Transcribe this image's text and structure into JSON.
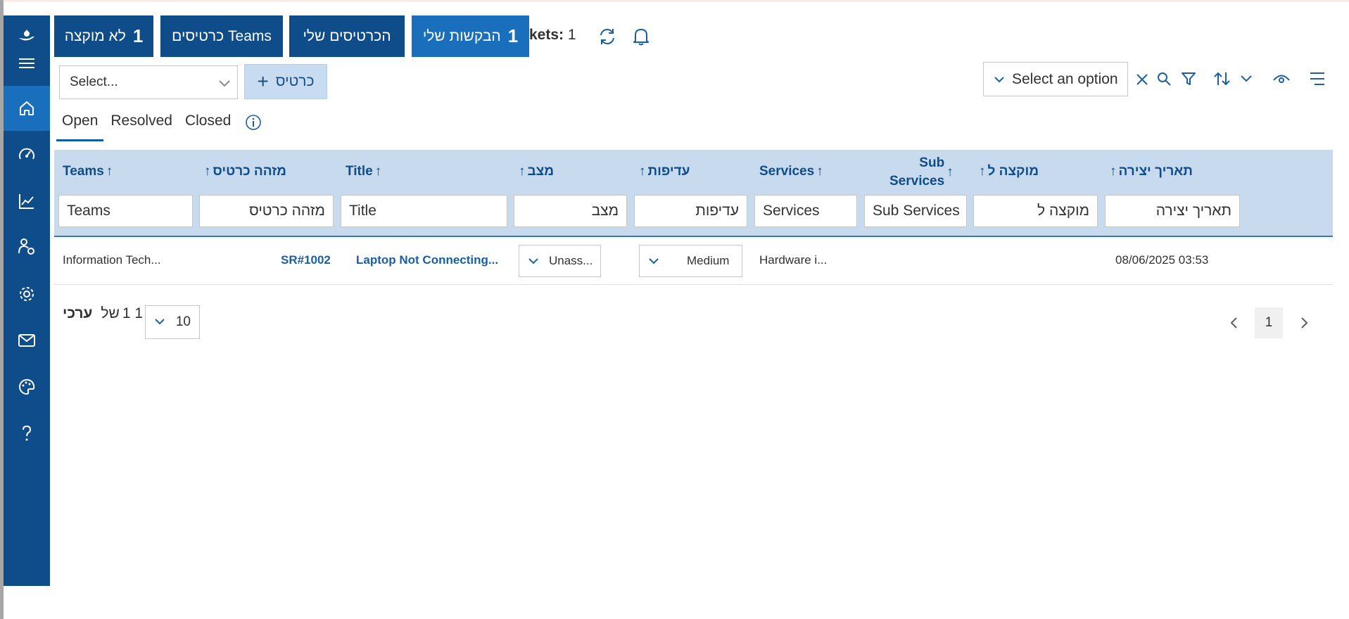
{
  "tabs": {
    "unassigned": {
      "count": "1",
      "label": "לא מוקצה"
    },
    "team_tickets": {
      "label": "Teams כרטיסים"
    },
    "my_tickets": {
      "label": "הכרטיסים שלי"
    },
    "my_requests": {
      "count": "1",
      "label": "הבקשות שלי"
    }
  },
  "tickets_count": {
    "label": "kets:",
    "value": "1"
  },
  "select": {
    "placeholder": "Select..."
  },
  "add_ticket": {
    "label": "כרטיס"
  },
  "option_select": {
    "label": "Select an option"
  },
  "view_tabs": [
    "Open",
    "Resolved",
    "Closed"
  ],
  "columns": {
    "teams": "Teams",
    "ticket_id": "מזהה כרטיס",
    "title": "Title",
    "status": "מצב",
    "priority": "עדיפות",
    "services": "Services",
    "sub_services_1": "Sub",
    "sub_services_2": "Services",
    "assigned_to": "מוקצה ל",
    "created": "תאריך יצירה"
  },
  "filters": {
    "teams": "Teams",
    "ticket_id": "מזהה כרטיס",
    "title": "Title",
    "status": "מצב",
    "priority": "עדיפות",
    "services": "Services",
    "sub_services": "Sub Services",
    "assigned_to": "מוקצה ל",
    "created": "תאריך יצירה"
  },
  "rows": [
    {
      "teams": "Information Tech...",
      "ticket_id": "SR#1002",
      "title": "Laptop Not Connecting...",
      "status": "Unass...",
      "priority": "Medium",
      "services": "Hardware i...",
      "sub_services": "",
      "assigned_to": "",
      "created": "08/06/2025 03:53"
    }
  ],
  "pagination": {
    "values_label": "ערכי",
    "of_label": "של",
    "range": "1 1",
    "page_size": "10",
    "current_page": "1"
  },
  "colors": {
    "sidebar": "#0f4c8a",
    "active": "#1a6fbd",
    "header_bg": "#c7daee",
    "link": "#1a5fa5"
  }
}
